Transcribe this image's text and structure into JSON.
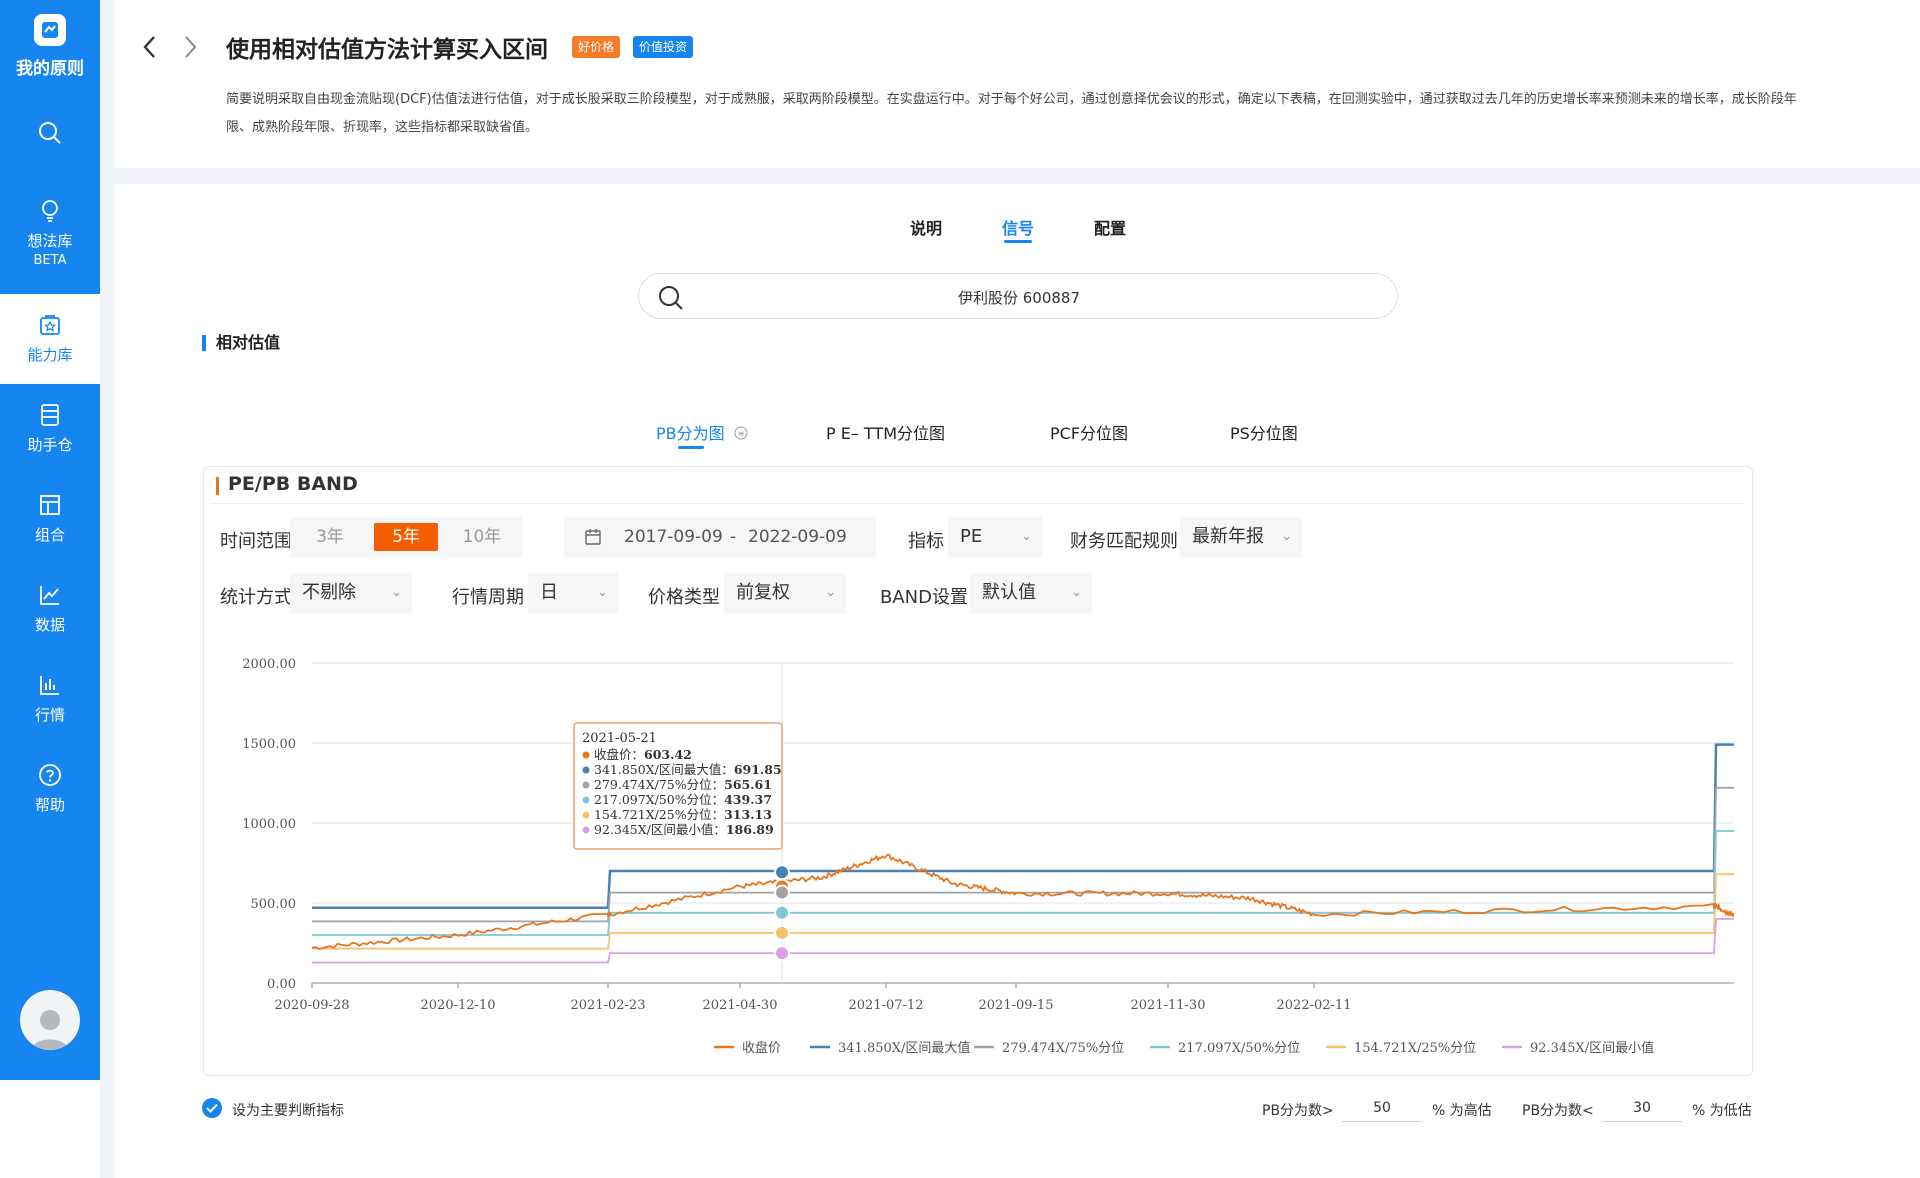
{
  "app": {
    "logo_text": "我的原则"
  },
  "sidebar": {
    "items": [
      {
        "label": "想法库",
        "sub": "BETA",
        "icon": "bulb-icon"
      },
      {
        "label": "能力库",
        "icon": "capability-icon"
      },
      {
        "label": "助手仓",
        "icon": "assistant-icon"
      },
      {
        "label": "组合",
        "icon": "portfolio-icon"
      },
      {
        "label": "数据",
        "icon": "data-icon"
      },
      {
        "label": "行情",
        "icon": "market-icon"
      },
      {
        "label": "帮助",
        "icon": "help-icon"
      }
    ]
  },
  "header": {
    "title": "使用相对估值方法计算买入区间",
    "tags": [
      "好价格",
      "价值投资"
    ],
    "description": "简要说明采取自由现金流贴现(DCF)估值法进行估值，对于成长股采取三阶段模型，对于成熟服，采取两阶段模型。在实盘运行中。对于每个好公司，通过创意择优会议的形式，确定以下表稿，在回测实验中，通过获取过去几年的历史增长率来预测未来的增长率，成长阶段年限、成熟阶段年限、折现率，这些指标都采取缺省值。"
  },
  "tabs": [
    "说明",
    "信号",
    "配置"
  ],
  "active_tab": "信号",
  "search": {
    "value": "伊利股份 600887"
  },
  "section_title": "相对估值",
  "subtabs": [
    "PB分为图",
    "P E– TTM分位图",
    "PCF分位图",
    "PS分位图"
  ],
  "card": {
    "title": "PE/PB BAND",
    "time_range_label": "时间范围",
    "time_options": [
      "3年",
      "5年",
      "10年"
    ],
    "time_active": "5年",
    "date_start": "2017-09-09",
    "date_end": "2022-09-09",
    "indicator_label": "指标",
    "indicator_value": "PE",
    "fin_match_label": "财务匹配规则",
    "fin_match_value": "最新年报",
    "stat_label": "统计方式",
    "stat_value": "不剔除",
    "period_label": "行情周期",
    "period_value": "日",
    "price_type_label": "价格类型",
    "price_type_value": "前复权",
    "band_label": "BAND设置",
    "band_value": "默认值"
  },
  "chart_data": {
    "type": "line",
    "y_ticks": [
      "0.00",
      "500.00",
      "1000.00",
      "1500.00",
      "2000.00"
    ],
    "ylim": [
      0,
      2000
    ],
    "x_ticks": [
      "2020-09-28",
      "2020-12-10",
      "2021-02-23",
      "2021-04-30",
      "2021-07-12",
      "2021-09-15",
      "2021-11-30",
      "2022-02-11"
    ],
    "series": [
      {
        "name": "收盘价",
        "color": "#e8761e"
      },
      {
        "name": "341.850X/区间最大值",
        "color": "#4682b4"
      },
      {
        "name": "279.474X/75%分位",
        "color": "#a0a4a8"
      },
      {
        "name": "217.097X/50%分位",
        "color": "#7ec8d8"
      },
      {
        "name": "154.721X/25%分位",
        "color": "#f5c26b"
      },
      {
        "name": "92.345X/区间最小值",
        "color": "#d9a0e8"
      }
    ],
    "x": [
      "2020-09-28",
      "2020-12-10",
      "2021-02-23",
      "2021-02-24",
      "2021-04-30",
      "2021-06-10",
      "2021-07-12",
      "2021-08-15",
      "2021-09-15",
      "2021-11-30",
      "2022-01-10",
      "2022-02-11",
      "2022-08-30",
      "2022-08-31",
      "2022-09-09"
    ],
    "values": {
      "收盘价": [
        220,
        300,
        430,
        430,
        603,
        660,
        800,
        620,
        560,
        560,
        530,
        430,
        480,
        480,
        420
      ],
      "341.850X/区间最大值": [
        470,
        470,
        470,
        700,
        700,
        700,
        700,
        700,
        700,
        700,
        700,
        700,
        700,
        1490,
        1490
      ],
      "279.474X/75%分位": [
        385,
        385,
        385,
        565,
        565,
        565,
        565,
        565,
        565,
        565,
        565,
        565,
        565,
        1220,
        1220
      ],
      "217.097X/50%分位": [
        300,
        300,
        300,
        439,
        439,
        439,
        439,
        439,
        439,
        439,
        439,
        439,
        439,
        950,
        950
      ],
      "154.721X/25%分位": [
        215,
        215,
        215,
        313,
        313,
        313,
        313,
        313,
        313,
        313,
        313,
        313,
        313,
        680,
        680
      ],
      "92.345X/区间最小值": [
        128,
        128,
        128,
        187,
        187,
        187,
        187,
        187,
        187,
        187,
        187,
        187,
        187,
        400,
        400
      ]
    },
    "tooltip": {
      "date": "2021-05-21",
      "rows": [
        {
          "label": "收盘价",
          "value": "603.42"
        },
        {
          "label": "341.850X/区间最大值",
          "value": "691.85"
        },
        {
          "label": "279.474X/75%分位",
          "value": "565.61"
        },
        {
          "label": "217.097X/50%分位",
          "value": "439.37"
        },
        {
          "label": "154.721X/25%分位",
          "value": "313.13"
        },
        {
          "label": "92.345X/区间最小值",
          "value": "186.89"
        }
      ]
    }
  },
  "footer": {
    "checkbox_label": "设为主要判断指标",
    "high_prefix": "PB分为数>",
    "high_value": "50",
    "high_suffix": "% 为高估",
    "low_prefix": "PB分为数<",
    "low_value": "30",
    "low_suffix": "% 为低估"
  }
}
